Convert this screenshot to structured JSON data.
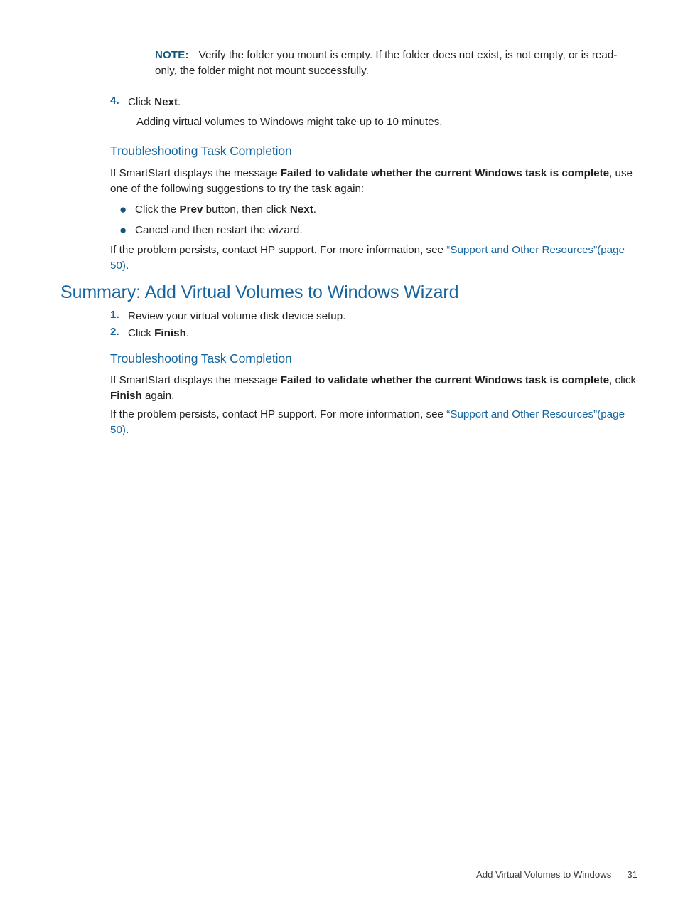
{
  "note": {
    "label": "NOTE:",
    "text": "Verify the folder you mount is empty. If the folder does not exist, is not empty, or is read-only, the folder might not mount successfully."
  },
  "step4": {
    "number": "4.",
    "lead": "Click ",
    "bold": "Next",
    "trail": ".",
    "sub": "Adding virtual volumes to Windows might take up to 10 minutes."
  },
  "troubleshooting_1": {
    "heading": "Troubleshooting Task Completion",
    "intro_lead": "If SmartStart displays the message ",
    "intro_bold": "Failed to validate whether the current Windows task is complete",
    "intro_trail": ", use one of the following suggestions to try the task again:",
    "bullets": [
      {
        "lead": "Click the ",
        "bold1": "Prev",
        "mid": " button, then click ",
        "bold2": "Next",
        "trail": "."
      },
      {
        "lead": "Cancel and then restart the wizard.",
        "bold1": "",
        "mid": "",
        "bold2": "",
        "trail": ""
      }
    ],
    "persist_lead": "If the problem persists, contact HP support. For more information, see ",
    "persist_link": "“Support and Other Resources”",
    "persist_link2": "(page 50)",
    "persist_trail": "."
  },
  "summary": {
    "heading": "Summary: Add Virtual Volumes to Windows Wizard",
    "steps": [
      {
        "number": "1.",
        "lead": "Review your virtual volume disk device setup.",
        "bold": "",
        "trail": ""
      },
      {
        "number": "2.",
        "lead": "Click ",
        "bold": "Finish",
        "trail": "."
      }
    ]
  },
  "troubleshooting_2": {
    "heading": "Troubleshooting Task Completion",
    "intro_lead": "If SmartStart displays the message ",
    "intro_bold": "Failed to validate whether the current Windows task is complete",
    "intro_mid": ", click ",
    "intro_bold2": "Finish",
    "intro_trail": " again.",
    "persist_lead": "If the problem persists, contact HP support. For more information, see ",
    "persist_link": "“Support and Other Resources”",
    "persist_link2": "(page 50)",
    "persist_trail": "."
  },
  "footer": {
    "chapter": "Add Virtual Volumes to Windows",
    "page": "31"
  },
  "colors": {
    "heading_blue": "#1464a0",
    "note_blue": "#14557f",
    "body_text": "#231f20"
  }
}
